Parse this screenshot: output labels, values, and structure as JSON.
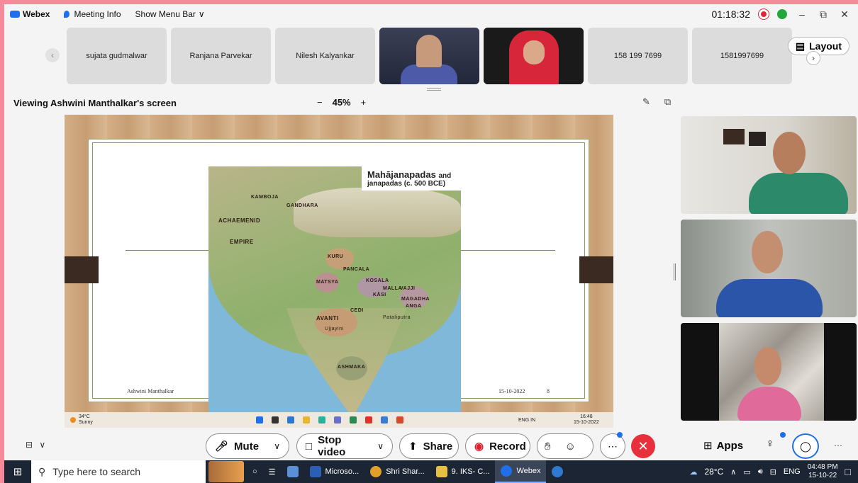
{
  "topbar": {
    "app_name": "Webex",
    "meeting_info": "Meeting Info",
    "show_menu_bar": "Show Menu Bar",
    "timer": "01:18:32"
  },
  "participants": [
    {
      "name": "sujata gudmalwar",
      "video": false
    },
    {
      "name": "Ranjana Parvekar",
      "video": false
    },
    {
      "name": "Nilesh Kalyankar",
      "video": false
    },
    {
      "name": "",
      "video": true
    },
    {
      "name": "",
      "video": true
    },
    {
      "name": "158 199 7699",
      "video": false
    },
    {
      "name": "1581997699",
      "video": false
    }
  ],
  "layout_label": "Layout",
  "viewing": {
    "label": "Viewing Ashwini Manthalkar's screen",
    "zoom_minus": "−",
    "zoom_value": "45%",
    "zoom_plus": "+"
  },
  "slide": {
    "map_title_main": "Mahājanapadas",
    "map_title_and": "and",
    "map_title_sub": "janapadas (c. 500 BCE)",
    "footer_author": "Ashwini Manthalkar",
    "footer_date": "15-10-2022",
    "footer_page": "8",
    "map_labels": [
      "KAMBOJA",
      "GANDHARA",
      "ACHAEMENID",
      "EMPIRE",
      "KURU",
      "PANCALA",
      "MATSYA",
      "KOSALA",
      "MALLA",
      "VAJJI",
      "KĀSI",
      "MAGADHA",
      "ANGA",
      "AVANTI",
      "CEDI",
      "ASHMAKA",
      "Pataliputra",
      "Ujjayini"
    ],
    "mini_weather_temp": "34°C",
    "mini_weather_desc": "Sunny",
    "mini_time": "16:48",
    "mini_date": "15-10-2022",
    "mini_lang": "ENG IN"
  },
  "controls": {
    "mute": "Mute",
    "stop_video": "Stop video",
    "share": "Share",
    "record": "Record",
    "apps": "Apps"
  },
  "taskbar": {
    "search_placeholder": "Type here to search",
    "apps": [
      "Microso...",
      "Shri Shar...",
      "9. IKS- C...",
      "Webex"
    ],
    "weather": "28°C",
    "lang": "ENG",
    "time": "04:48 PM",
    "date": "15-10-22"
  },
  "colors": {
    "accent": "#1f6feb",
    "end_call": "#e8303c",
    "frame_border": "#f48a9a"
  }
}
